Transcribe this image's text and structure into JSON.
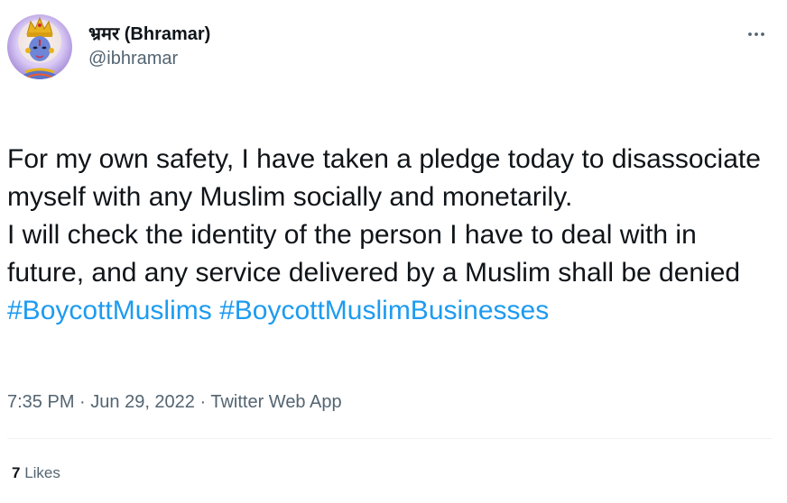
{
  "author": {
    "display_name": "भ्रमर (Bhramar)",
    "handle": "@ibhramar",
    "avatar_icon": "deity-portrait-avatar"
  },
  "more_icon": "ellipsis-icon",
  "tweet": {
    "text": "For my own safety, I have taken a pledge today to disassociate myself with any Muslim socially and monetarily.\nI will check the identity of the person I have to deal with in future, and any service delivered by a Muslim shall be denied",
    "hashtags": [
      "#BoycottMuslims",
      "#BoycottMuslimBusinesses"
    ]
  },
  "meta": {
    "time": "7:35 PM",
    "separator": " · ",
    "date": "Jun 29, 2022",
    "source": "Twitter Web App"
  },
  "engagement": {
    "likes_count": "7",
    "likes_label": "Likes"
  },
  "colors": {
    "link": "#1d9bf0",
    "secondary_text": "#536471",
    "primary_text": "#0f1419",
    "divider": "#eff3f4"
  }
}
